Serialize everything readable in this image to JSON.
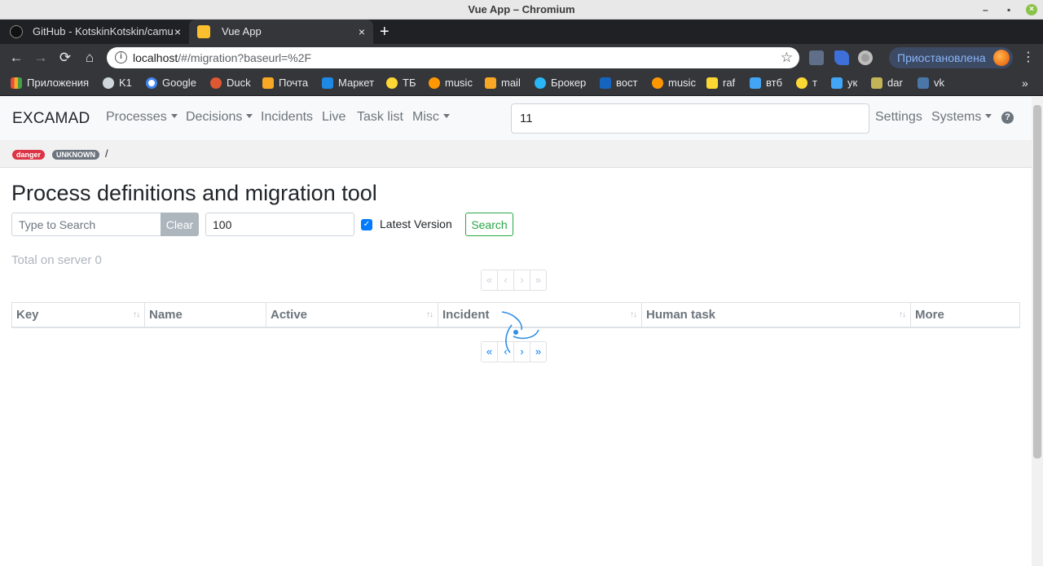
{
  "window": {
    "title": "Vue App – Chromium",
    "min": "–",
    "max": "▪",
    "close": "×"
  },
  "tabs": [
    {
      "label": "GitHub - KotskinKotskin/camu",
      "close": "×"
    },
    {
      "label": "Vue App",
      "close": "×"
    }
  ],
  "new_tab": "+",
  "toolbar": {
    "back": "←",
    "forward": "→",
    "reload": "⟳",
    "home": "⌂",
    "url_host": "localhost",
    "url_rest": "/#/migration?baseurl=%2F",
    "info": "i",
    "star": "☆",
    "profile": "Приостановлена",
    "menu": "⋮"
  },
  "bookmarks": [
    {
      "label": "Приложения",
      "color": "#e84c3d"
    },
    {
      "label": "K1",
      "color": "#cfd8dc"
    },
    {
      "label": "Google",
      "color": "#ffffff"
    },
    {
      "label": "Duck",
      "color": "#de5833"
    },
    {
      "label": "Почта",
      "color": "#f9a825"
    },
    {
      "label": "Маркет",
      "color": "#1e88e5"
    },
    {
      "label": "ТБ",
      "color": "#fdd835"
    },
    {
      "label": "music",
      "color": "#ff9800"
    },
    {
      "label": "mail",
      "color": "#f9a825"
    },
    {
      "label": "Брокер",
      "color": "#29b6f6"
    },
    {
      "label": "вост",
      "color": "#1565c0"
    },
    {
      "label": "music",
      "color": "#ff9800"
    },
    {
      "label": "raf",
      "color": "#fdd835"
    },
    {
      "label": "втб",
      "color": "#42a5f5"
    },
    {
      "label": "т",
      "color": "#fdd835"
    },
    {
      "label": "ук",
      "color": "#42a5f5"
    },
    {
      "label": "dar",
      "color": "#c5b358"
    },
    {
      "label": "vk",
      "color": "#4a76a8"
    }
  ],
  "bookmarks_more": "»",
  "navbar": {
    "brand": "EXCAMAD",
    "items": [
      "Processes",
      "Decisions",
      "Incidents",
      "Live",
      "Task list",
      "Misc"
    ],
    "search_value": "11",
    "settings": "Settings",
    "systems": "Systems",
    "help": "?"
  },
  "breadcrumb": {
    "badge_danger": "danger",
    "badge_unknown": "UNKNOWN",
    "sep": "/"
  },
  "main": {
    "title": "Process definitions and migration tool",
    "search_placeholder": "Type to Search",
    "clear_label": "Clear",
    "limit_value": "100",
    "latest_version_label": "Latest Version",
    "latest_version_checked": true,
    "search_label": "Search",
    "total_text": "Total on server 0"
  },
  "pager": [
    "«",
    "‹",
    "›",
    "»"
  ],
  "table": {
    "columns": [
      "Key",
      "Name",
      "Active",
      "Incident",
      "Human task",
      "More"
    ],
    "sort_icon": "↑↓"
  },
  "colors": {
    "danger": "#dc3545",
    "secondary": "#6c757d",
    "primary": "#007bff",
    "success": "#28a745"
  }
}
